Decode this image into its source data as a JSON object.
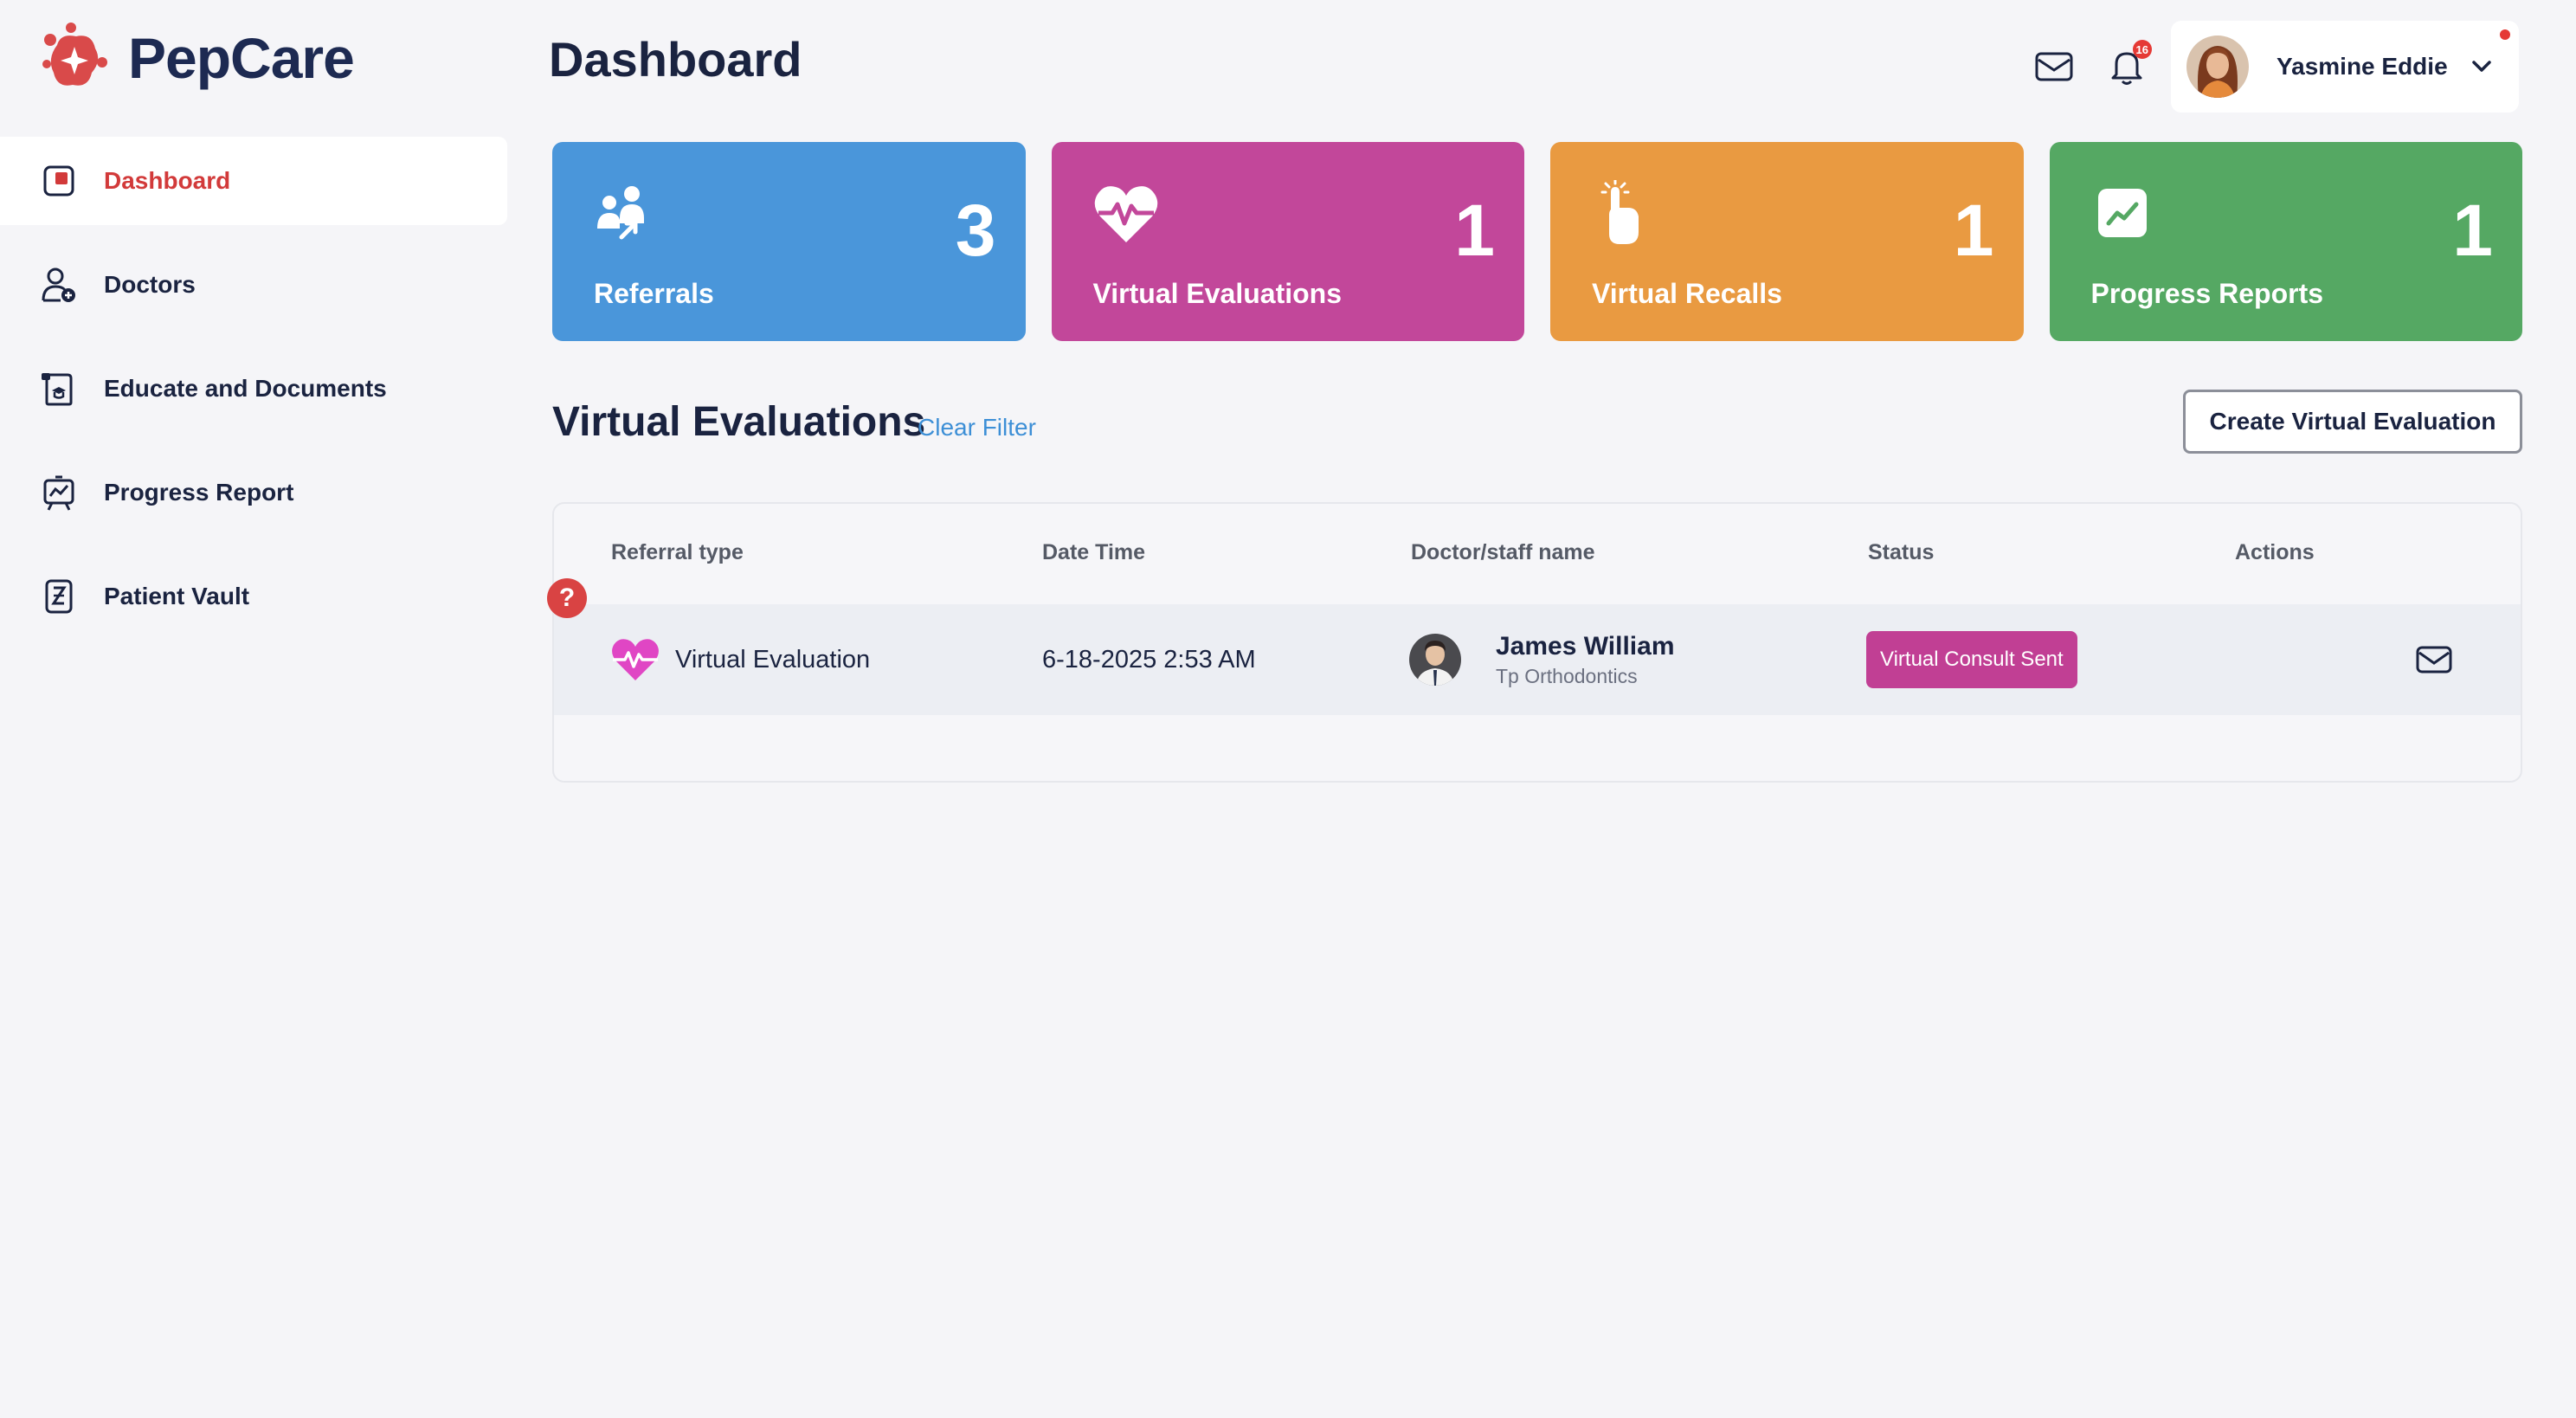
{
  "app": {
    "name": "PepCare"
  },
  "header": {
    "title": "Dashboard",
    "notification_count": "16",
    "user": {
      "name": "Yasmine Eddie"
    }
  },
  "sidebar": {
    "items": [
      {
        "label": "Dashboard",
        "icon": "dashboard-icon",
        "active": true
      },
      {
        "label": "Doctors",
        "icon": "doctor-add-icon",
        "active": false
      },
      {
        "label": "Educate and Documents",
        "icon": "education-document-icon",
        "active": false
      },
      {
        "label": "Progress Report",
        "icon": "progress-board-icon",
        "active": false
      },
      {
        "label": "Patient Vault",
        "icon": "vault-icon",
        "active": false
      }
    ]
  },
  "cards": [
    {
      "label": "Referrals",
      "count": "3",
      "color": "#4a96da",
      "icon": "referral-people-icon"
    },
    {
      "label": "Virtual Evaluations",
      "count": "1",
      "color": "#c2479a",
      "icon": "heart-pulse-icon"
    },
    {
      "label": "Virtual Recalls",
      "count": "1",
      "color": "#e99a41",
      "icon": "finger-reminder-icon"
    },
    {
      "label": "Progress Reports",
      "count": "1",
      "color": "#55a863",
      "icon": "trend-chart-icon"
    }
  ],
  "section": {
    "title": "Virtual Evaluations",
    "clear_filter": "Clear Filter",
    "create_button": "Create Virtual Evaluation"
  },
  "table": {
    "columns": [
      "Referral type",
      "Date Time",
      "Doctor/staff name",
      "Status",
      "Actions"
    ],
    "rows": [
      {
        "referral_type": "Virtual Evaluation",
        "datetime": "6-18-2025 2:53 AM",
        "doctor_name": "James William",
        "doctor_org": "Tp Orthodontics",
        "status": "Virtual Consult Sent",
        "status_color": "#c13f94"
      }
    ]
  },
  "colors": {
    "accent_red": "#d23a3a",
    "link_blue": "#3d8fd6",
    "text_dark": "#1a2340"
  }
}
